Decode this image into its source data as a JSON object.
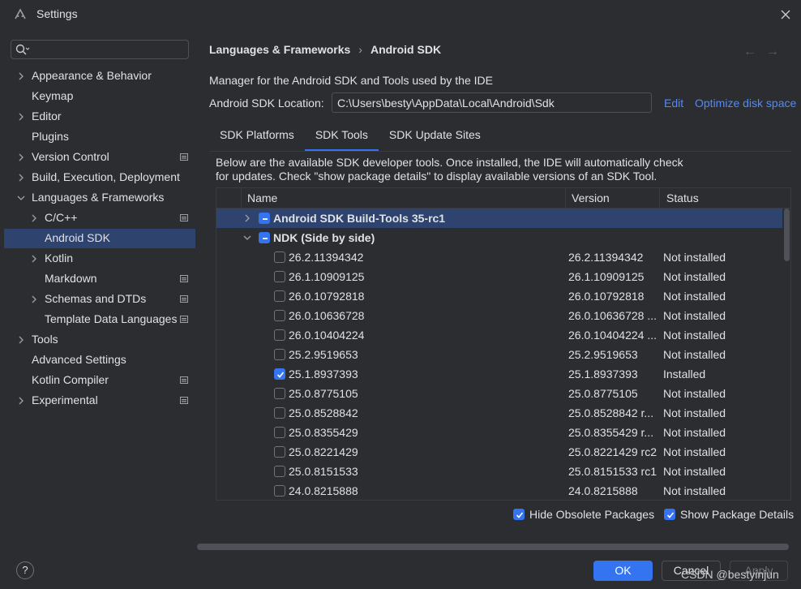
{
  "window": {
    "title": "Settings"
  },
  "sidebar": {
    "search_placeholder": "",
    "items": [
      {
        "label": "Appearance & Behavior",
        "expandable": true,
        "expanded": false,
        "selected": false,
        "project_level": false
      },
      {
        "label": "Keymap",
        "expandable": false,
        "expanded": false,
        "selected": false,
        "project_level": false
      },
      {
        "label": "Editor",
        "expandable": true,
        "expanded": false,
        "selected": false,
        "project_level": false
      },
      {
        "label": "Plugins",
        "expandable": false,
        "expanded": false,
        "selected": false,
        "project_level": false
      },
      {
        "label": "Version Control",
        "expandable": true,
        "expanded": false,
        "selected": false,
        "project_level": true
      },
      {
        "label": "Build, Execution, Deployment",
        "expandable": true,
        "expanded": false,
        "selected": false,
        "project_level": false
      },
      {
        "label": "Languages & Frameworks",
        "expandable": true,
        "expanded": true,
        "selected": false,
        "project_level": false
      },
      {
        "label": "C/C++",
        "expandable": true,
        "expanded": false,
        "selected": false,
        "project_level": true
      },
      {
        "label": "Android SDK",
        "expandable": false,
        "expanded": false,
        "selected": true,
        "project_level": false
      },
      {
        "label": "Kotlin",
        "expandable": true,
        "expanded": false,
        "selected": false,
        "project_level": false
      },
      {
        "label": "Markdown",
        "expandable": false,
        "expanded": false,
        "selected": false,
        "project_level": true
      },
      {
        "label": "Schemas and DTDs",
        "expandable": true,
        "expanded": false,
        "selected": false,
        "project_level": true
      },
      {
        "label": "Template Data Languages",
        "expandable": false,
        "expanded": false,
        "selected": false,
        "project_level": true
      },
      {
        "label": "Tools",
        "expandable": true,
        "expanded": false,
        "selected": false,
        "project_level": false
      },
      {
        "label": "Advanced Settings",
        "expandable": false,
        "expanded": false,
        "selected": false,
        "project_level": false
      },
      {
        "label": "Kotlin Compiler",
        "expandable": false,
        "expanded": false,
        "selected": false,
        "project_level": true
      },
      {
        "label": "Experimental",
        "expandable": true,
        "expanded": false,
        "selected": false,
        "project_level": true
      }
    ]
  },
  "breadcrumb": {
    "parent": "Languages & Frameworks",
    "separator": "›",
    "current": "Android SDK"
  },
  "nav": {
    "back": "←",
    "forward": "→"
  },
  "main": {
    "description": "Manager for the Android SDK and Tools used by the IDE",
    "location_label": "Android SDK Location:",
    "location_value": "C:\\Users\\besty\\AppData\\Local\\Android\\Sdk",
    "edit_link": "Edit",
    "optimize_link": "Optimize disk space",
    "tabs": [
      {
        "label": "SDK Platforms",
        "active": false
      },
      {
        "label": "SDK Tools",
        "active": true
      },
      {
        "label": "SDK Update Sites",
        "active": false
      }
    ],
    "info_line1": "Below are the available SDK developer tools. Once installed, the IDE will automatically check",
    "info_line2": "for updates. Check \"show package details\" to display available versions of an SDK Tool.",
    "table": {
      "columns": [
        "Name",
        "Version",
        "Status"
      ],
      "rows": [
        {
          "name": "Android SDK Build-Tools 35-rc1",
          "version": "",
          "status": "",
          "group": true,
          "expanded": false,
          "check": "partial",
          "selected": true
        },
        {
          "name": "NDK (Side by side)",
          "version": "",
          "status": "",
          "group": true,
          "expanded": true,
          "check": "partial",
          "selected": false
        },
        {
          "name": "26.2.11394342",
          "version": "26.2.11394342",
          "status": "Not installed",
          "check": "none"
        },
        {
          "name": "26.1.10909125",
          "version": "26.1.10909125",
          "status": "Not installed",
          "check": "none"
        },
        {
          "name": "26.0.10792818",
          "version": "26.0.10792818",
          "status": "Not installed",
          "check": "none"
        },
        {
          "name": "26.0.10636728",
          "version": "26.0.10636728 ...",
          "status": "Not installed",
          "check": "none"
        },
        {
          "name": "26.0.10404224",
          "version": "26.0.10404224 ...",
          "status": "Not installed",
          "check": "none"
        },
        {
          "name": "25.2.9519653",
          "version": "25.2.9519653",
          "status": "Not installed",
          "check": "none"
        },
        {
          "name": "25.1.8937393",
          "version": "25.1.8937393",
          "status": "Installed",
          "check": "checked"
        },
        {
          "name": "25.0.8775105",
          "version": "25.0.8775105",
          "status": "Not installed",
          "check": "none"
        },
        {
          "name": "25.0.8528842",
          "version": "25.0.8528842 r...",
          "status": "Not installed",
          "check": "none"
        },
        {
          "name": "25.0.8355429",
          "version": "25.0.8355429 r...",
          "status": "Not installed",
          "check": "none"
        },
        {
          "name": "25.0.8221429",
          "version": "25.0.8221429 rc2",
          "status": "Not installed",
          "check": "none"
        },
        {
          "name": "25.0.8151533",
          "version": "25.0.8151533 rc1",
          "status": "Not installed",
          "check": "none"
        },
        {
          "name": "24.0.8215888",
          "version": "24.0.8215888",
          "status": "Not installed",
          "check": "none"
        }
      ]
    },
    "hide_obsolete": {
      "label": "Hide Obsolete Packages",
      "checked": true
    },
    "show_details": {
      "label": "Show Package Details",
      "checked": true
    }
  },
  "footer": {
    "help": "?",
    "ok": "OK",
    "cancel": "Cancel",
    "apply": "Apply"
  },
  "watermark": "CSDN @bestyinjun",
  "colors": {
    "background": "#2b2d30",
    "selection": "#2e436e",
    "accent": "#3574f0",
    "link": "#548af7"
  }
}
